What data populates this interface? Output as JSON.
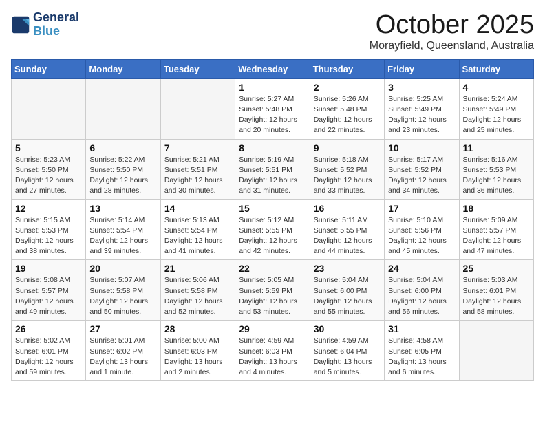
{
  "header": {
    "logo_line1": "General",
    "logo_line2": "Blue",
    "title": "October 2025",
    "subtitle": "Morayfield, Queensland, Australia"
  },
  "weekdays": [
    "Sunday",
    "Monday",
    "Tuesday",
    "Wednesday",
    "Thursday",
    "Friday",
    "Saturday"
  ],
  "weeks": [
    [
      {
        "day": "",
        "info": ""
      },
      {
        "day": "",
        "info": ""
      },
      {
        "day": "",
        "info": ""
      },
      {
        "day": "1",
        "info": "Sunrise: 5:27 AM\nSunset: 5:48 PM\nDaylight: 12 hours\nand 20 minutes."
      },
      {
        "day": "2",
        "info": "Sunrise: 5:26 AM\nSunset: 5:48 PM\nDaylight: 12 hours\nand 22 minutes."
      },
      {
        "day": "3",
        "info": "Sunrise: 5:25 AM\nSunset: 5:49 PM\nDaylight: 12 hours\nand 23 minutes."
      },
      {
        "day": "4",
        "info": "Sunrise: 5:24 AM\nSunset: 5:49 PM\nDaylight: 12 hours\nand 25 minutes."
      }
    ],
    [
      {
        "day": "5",
        "info": "Sunrise: 5:23 AM\nSunset: 5:50 PM\nDaylight: 12 hours\nand 27 minutes."
      },
      {
        "day": "6",
        "info": "Sunrise: 5:22 AM\nSunset: 5:50 PM\nDaylight: 12 hours\nand 28 minutes."
      },
      {
        "day": "7",
        "info": "Sunrise: 5:21 AM\nSunset: 5:51 PM\nDaylight: 12 hours\nand 30 minutes."
      },
      {
        "day": "8",
        "info": "Sunrise: 5:19 AM\nSunset: 5:51 PM\nDaylight: 12 hours\nand 31 minutes."
      },
      {
        "day": "9",
        "info": "Sunrise: 5:18 AM\nSunset: 5:52 PM\nDaylight: 12 hours\nand 33 minutes."
      },
      {
        "day": "10",
        "info": "Sunrise: 5:17 AM\nSunset: 5:52 PM\nDaylight: 12 hours\nand 34 minutes."
      },
      {
        "day": "11",
        "info": "Sunrise: 5:16 AM\nSunset: 5:53 PM\nDaylight: 12 hours\nand 36 minutes."
      }
    ],
    [
      {
        "day": "12",
        "info": "Sunrise: 5:15 AM\nSunset: 5:53 PM\nDaylight: 12 hours\nand 38 minutes."
      },
      {
        "day": "13",
        "info": "Sunrise: 5:14 AM\nSunset: 5:54 PM\nDaylight: 12 hours\nand 39 minutes."
      },
      {
        "day": "14",
        "info": "Sunrise: 5:13 AM\nSunset: 5:54 PM\nDaylight: 12 hours\nand 41 minutes."
      },
      {
        "day": "15",
        "info": "Sunrise: 5:12 AM\nSunset: 5:55 PM\nDaylight: 12 hours\nand 42 minutes."
      },
      {
        "day": "16",
        "info": "Sunrise: 5:11 AM\nSunset: 5:55 PM\nDaylight: 12 hours\nand 44 minutes."
      },
      {
        "day": "17",
        "info": "Sunrise: 5:10 AM\nSunset: 5:56 PM\nDaylight: 12 hours\nand 45 minutes."
      },
      {
        "day": "18",
        "info": "Sunrise: 5:09 AM\nSunset: 5:57 PM\nDaylight: 12 hours\nand 47 minutes."
      }
    ],
    [
      {
        "day": "19",
        "info": "Sunrise: 5:08 AM\nSunset: 5:57 PM\nDaylight: 12 hours\nand 49 minutes."
      },
      {
        "day": "20",
        "info": "Sunrise: 5:07 AM\nSunset: 5:58 PM\nDaylight: 12 hours\nand 50 minutes."
      },
      {
        "day": "21",
        "info": "Sunrise: 5:06 AM\nSunset: 5:58 PM\nDaylight: 12 hours\nand 52 minutes."
      },
      {
        "day": "22",
        "info": "Sunrise: 5:05 AM\nSunset: 5:59 PM\nDaylight: 12 hours\nand 53 minutes."
      },
      {
        "day": "23",
        "info": "Sunrise: 5:04 AM\nSunset: 6:00 PM\nDaylight: 12 hours\nand 55 minutes."
      },
      {
        "day": "24",
        "info": "Sunrise: 5:04 AM\nSunset: 6:00 PM\nDaylight: 12 hours\nand 56 minutes."
      },
      {
        "day": "25",
        "info": "Sunrise: 5:03 AM\nSunset: 6:01 PM\nDaylight: 12 hours\nand 58 minutes."
      }
    ],
    [
      {
        "day": "26",
        "info": "Sunrise: 5:02 AM\nSunset: 6:01 PM\nDaylight: 12 hours\nand 59 minutes."
      },
      {
        "day": "27",
        "info": "Sunrise: 5:01 AM\nSunset: 6:02 PM\nDaylight: 13 hours\nand 1 minute."
      },
      {
        "day": "28",
        "info": "Sunrise: 5:00 AM\nSunset: 6:03 PM\nDaylight: 13 hours\nand 2 minutes."
      },
      {
        "day": "29",
        "info": "Sunrise: 4:59 AM\nSunset: 6:03 PM\nDaylight: 13 hours\nand 4 minutes."
      },
      {
        "day": "30",
        "info": "Sunrise: 4:59 AM\nSunset: 6:04 PM\nDaylight: 13 hours\nand 5 minutes."
      },
      {
        "day": "31",
        "info": "Sunrise: 4:58 AM\nSunset: 6:05 PM\nDaylight: 13 hours\nand 6 minutes."
      },
      {
        "day": "",
        "info": ""
      }
    ]
  ]
}
